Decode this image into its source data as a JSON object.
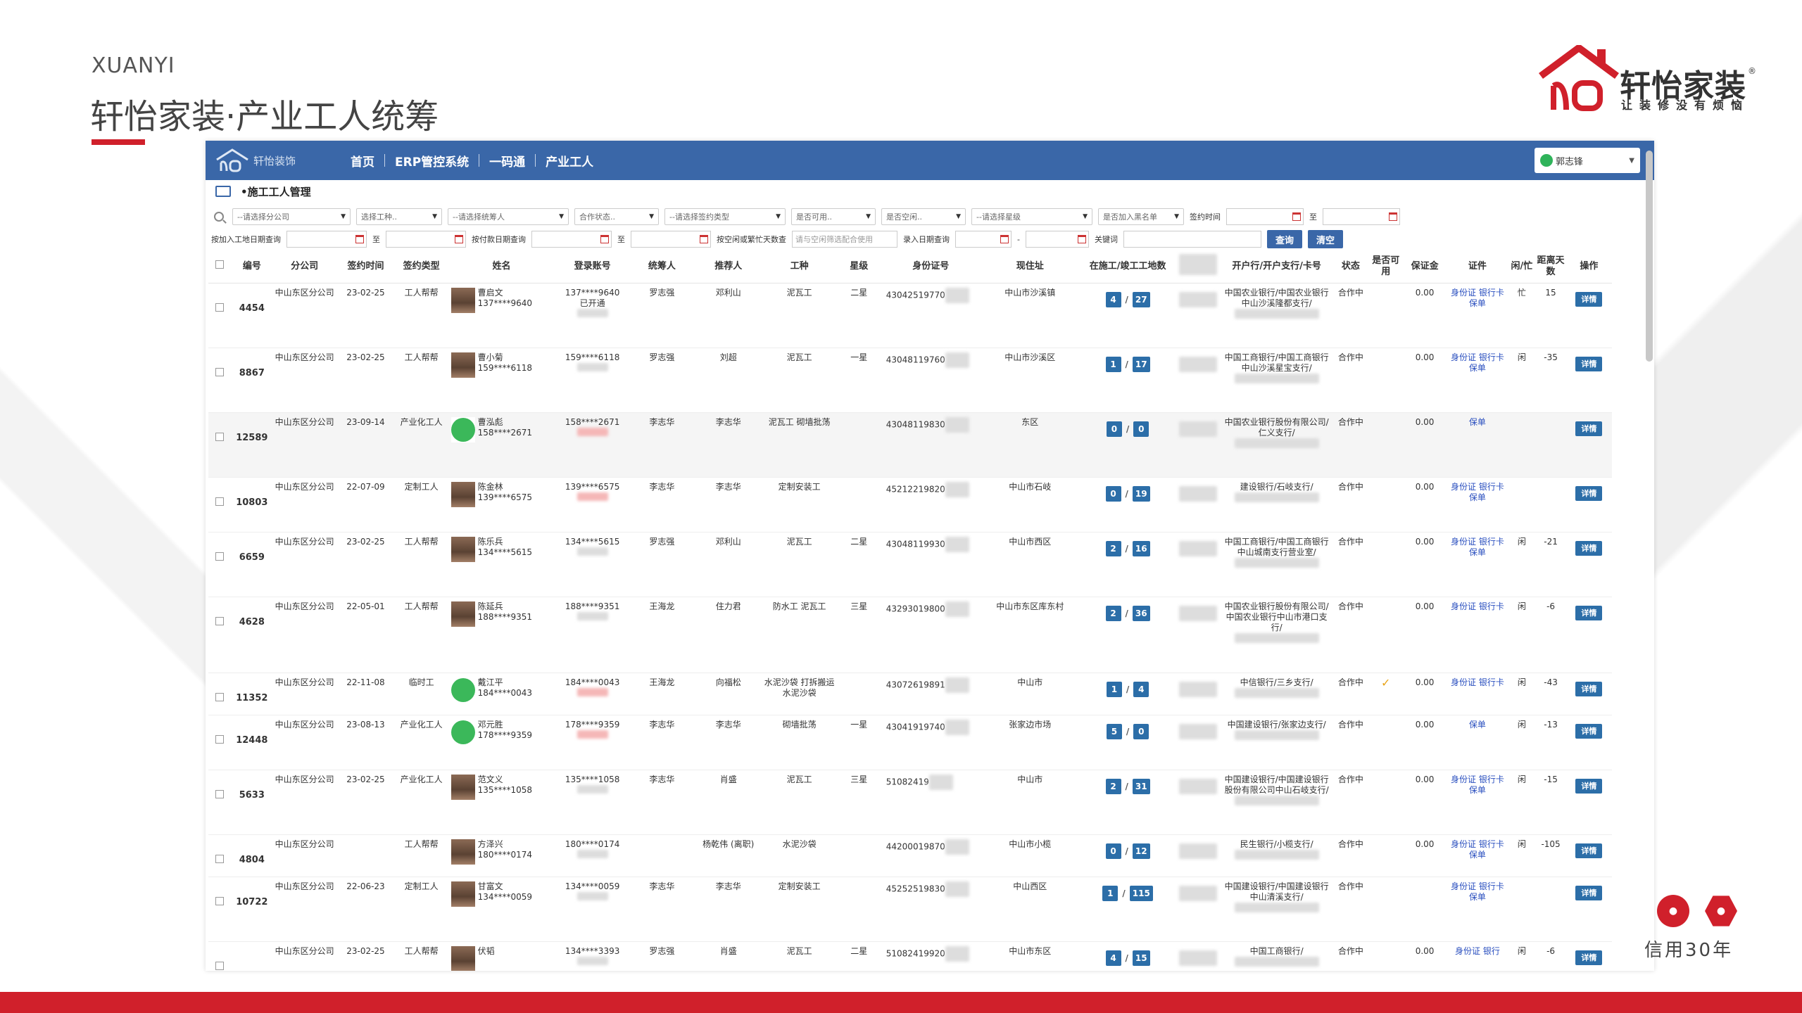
{
  "slide": {
    "brand_en": "XUANYI",
    "title": "轩怡家装·产业工人统筹",
    "logo_name": "轩怡家装",
    "logo_slogan": "让装修没有烦恼",
    "logo_reg": "®",
    "years_text": "信用30年",
    "colors": {
      "brand_red": "#d0202b",
      "nav_blue": "#3a67a8"
    }
  },
  "app": {
    "logo_text": "轩怡装饰",
    "nav": [
      "首页",
      "ERP管控系统",
      "一码通",
      "产业工人"
    ],
    "user_name": "郭志锋",
    "breadcrumb": "•施工工人管理",
    "filters": {
      "row1": [
        "--请选择分公司",
        "选择工种..",
        "--请选择统筹人",
        "合作状态..",
        "--请选择签约类型",
        "是否可用..",
        "是否空闲..",
        "--请选择星级",
        "是否加入黑名单"
      ],
      "sign_time_label": "签约时间",
      "to": "至",
      "join_site_label": "按加入工地日期查询",
      "pay_date_label": "按付款日期查询",
      "idle_label": "按空闲或繁忙天数查",
      "idle_placeholder": "请与空闲筛选配合使用",
      "entry_date_label": "录入日期查询",
      "dash": "-",
      "keyword_label": "关键词",
      "search_btn": "查询",
      "clear_btn": "清空"
    },
    "columns": [
      "编号",
      "分公司",
      "签约时间",
      "签约类型",
      "姓名",
      "登录账号",
      "统筹人",
      "推荐人",
      "工种",
      "星级",
      "身份证号",
      "现住址",
      "在施工/竣工工地数",
      "",
      "开户行/开户支行/卡号",
      "状态",
      "是否可用",
      "保证金",
      "证件",
      "闲/忙",
      "距离天数",
      "操作"
    ],
    "rows": [
      {
        "id": "4454",
        "branch": "中山东区分公司",
        "date": "23-02-25",
        "type": "工人帮帮",
        "name": "曹启文",
        "phone": "137****9640",
        "account": "137****9640",
        "account_note": "已开通",
        "coord": "罗志强",
        "ref": "邓利山",
        "trade": "泥瓦工",
        "star": "二星",
        "idno": "43042519770",
        "addr": "中山市沙溪镇",
        "active": "4",
        "done": "27",
        "bank": "中国农业银行/中国农业银行中山沙溪隆都支行/",
        "status": "合作中",
        "usable": "",
        "deposit": "0.00",
        "docs": "身份证 银行卡 保单",
        "idle": "忙",
        "days": "15",
        "op": "详情"
      },
      {
        "id": "8867",
        "branch": "中山东区分公司",
        "date": "23-02-25",
        "type": "工人帮帮",
        "name": "曹小菊",
        "phone": "159****6118",
        "account": "159****6118",
        "account_note": "",
        "coord": "罗志强",
        "ref": "刘超",
        "trade": "泥瓦工",
        "star": "一星",
        "idno": "43048119760",
        "addr": "中山市沙溪区",
        "active": "1",
        "done": "17",
        "bank": "中国工商银行/中国工商银行中山沙溪星宝支行/",
        "status": "合作中",
        "usable": "",
        "deposit": "0.00",
        "docs": "身份证 银行卡 保单",
        "idle": "闲",
        "days": "-35",
        "op": "详情"
      },
      {
        "id": "12589",
        "branch": "中山东区分公司",
        "date": "23-09-14",
        "type": "产业化工人",
        "name": "曹泓彪",
        "phone": "158****2671",
        "account": "158****2671",
        "account_note": "",
        "coord": "李志华",
        "ref": "李志华",
        "trade": "泥瓦工 砌墙批荡",
        "star": "",
        "idno": "43048119830",
        "addr": "东区",
        "active": "0",
        "done": "0",
        "bank": "中国农业银行股份有限公司/仁义支行/",
        "status": "合作中",
        "usable": "",
        "deposit": "0.00",
        "docs": "保单",
        "idle": "",
        "days": "",
        "op": "详情"
      },
      {
        "id": "10803",
        "branch": "中山东区分公司",
        "date": "22-07-09",
        "type": "定制工人",
        "name": "陈金林",
        "phone": "139****6575",
        "account": "139****6575",
        "account_note": "",
        "coord": "李志华",
        "ref": "李志华",
        "trade": "定制安装工",
        "star": "",
        "idno": "45212219820",
        "addr": "中山市石岐",
        "active": "0",
        "done": "19",
        "bank": "建设银行/石岐支行/",
        "status": "合作中",
        "usable": "",
        "deposit": "0.00",
        "docs": "身份证 银行卡 保单",
        "idle": "",
        "days": "",
        "op": "详情"
      },
      {
        "id": "6659",
        "branch": "中山东区分公司",
        "date": "23-02-25",
        "type": "工人帮帮",
        "name": "陈乐兵",
        "phone": "134****5615",
        "account": "134****5615",
        "account_note": "",
        "coord": "罗志强",
        "ref": "邓利山",
        "trade": "泥瓦工",
        "star": "二星",
        "idno": "43048119930",
        "addr": "中山市西区",
        "active": "2",
        "done": "16",
        "bank": "中国工商银行/中国工商银行中山城南支行营业室/",
        "status": "合作中",
        "usable": "",
        "deposit": "0.00",
        "docs": "身份证 银行卡 保单",
        "idle": "闲",
        "days": "-21",
        "op": "详情"
      },
      {
        "id": "4628",
        "branch": "中山东区分公司",
        "date": "22-05-01",
        "type": "工人帮帮",
        "name": "陈延兵",
        "phone": "188****9351",
        "account": "188****9351",
        "account_note": "",
        "coord": "王海龙",
        "ref": "住力君",
        "trade": "防水工 泥瓦工",
        "star": "三星",
        "idno": "43293019800",
        "addr": "中山市东区库东村",
        "active": "2",
        "done": "36",
        "bank": "中国农业银行股份有限公司/中国农业银行中山市港口支行/",
        "status": "合作中",
        "usable": "",
        "deposit": "0.00",
        "docs": "身份证 银行卡",
        "idle": "闲",
        "days": "-6",
        "op": "详情"
      },
      {
        "id": "11352",
        "branch": "中山东区分公司",
        "date": "22-11-08",
        "type": "临时工",
        "name": "戴江平",
        "phone": "184****0043",
        "account": "184****0043",
        "account_note": "",
        "coord": "王海龙",
        "ref": "向福松",
        "trade": "水泥沙袋 打拆搬运水泥沙袋",
        "star": "",
        "idno": "43072619891",
        "addr": "中山市",
        "active": "1",
        "done": "4",
        "bank": "中信银行/三乡支行/",
        "status": "合作中",
        "usable": "✓",
        "deposit": "0.00",
        "docs": "身份证 银行卡",
        "idle": "闲",
        "days": "-43",
        "op": "详情"
      },
      {
        "id": "12448",
        "branch": "中山东区分公司",
        "date": "23-08-13",
        "type": "产业化工人",
        "name": "邓元胜",
        "phone": "178****9359",
        "account": "178****9359",
        "account_note": "",
        "coord": "李志华",
        "ref": "李志华",
        "trade": "砌墙批荡",
        "star": "一星",
        "idno": "43041919740",
        "addr": "张家边市场",
        "active": "5",
        "done": "0",
        "bank": "中国建设银行/张家边支行/",
        "status": "合作中",
        "usable": "",
        "deposit": "0.00",
        "docs": "保单",
        "idle": "闲",
        "days": "-13",
        "op": "详情"
      },
      {
        "id": "5633",
        "branch": "中山东区分公司",
        "date": "23-02-25",
        "type": "产业化工人",
        "name": "范文义",
        "phone": "135****1058",
        "account": "135****1058",
        "account_note": "",
        "coord": "李志华",
        "ref": "肖盛",
        "trade": "泥瓦工",
        "star": "三星",
        "idno": "51082419",
        "addr": "中山市",
        "active": "2",
        "done": "31",
        "bank": "中国建设银行/中国建设银行股份有限公司中山石岐支行/",
        "status": "合作中",
        "usable": "",
        "deposit": "0.00",
        "docs": "身份证 银行卡 保单",
        "idle": "闲",
        "days": "-15",
        "op": "详情"
      },
      {
        "id": "4804",
        "branch": "中山东区分公司",
        "date": "",
        "type": "工人帮帮",
        "name": "方泽兴",
        "phone": "180****0174",
        "account": "180****0174",
        "account_note": "",
        "coord": "",
        "ref": "杨乾伟 (离职)",
        "trade": "水泥沙袋",
        "star": "",
        "idno": "44200019870",
        "addr": "中山市小榄",
        "active": "0",
        "done": "12",
        "bank": "民生银行/小榄支行/",
        "status": "合作中",
        "usable": "",
        "deposit": "0.00",
        "docs": "身份证 银行卡 保单",
        "idle": "闲",
        "days": "-105",
        "op": "详情"
      },
      {
        "id": "10722",
        "branch": "中山东区分公司",
        "date": "22-06-23",
        "type": "定制工人",
        "name": "甘富文",
        "phone": "134****0059",
        "account": "134****0059",
        "account_note": "",
        "coord": "李志华",
        "ref": "李志华",
        "trade": "定制安装工",
        "star": "",
        "idno": "45252519830",
        "addr": "中山西区",
        "active": "1",
        "done": "115",
        "bank": "中国建设银行/中国建设银行中山清溪支行/",
        "status": "合作中",
        "usable": "",
        "deposit": "",
        "docs": "身份证 银行卡 保单",
        "idle": "",
        "days": "",
        "op": "详情"
      },
      {
        "id": "",
        "branch": "中山东区分公司",
        "date": "23-02-25",
        "type": "工人帮帮",
        "name": "伏韬",
        "phone": "",
        "account": "134****3393",
        "account_note": "",
        "coord": "罗志强",
        "ref": "肖盛",
        "trade": "泥瓦工",
        "star": "二星",
        "idno": "51082419920",
        "addr": "中山市东区",
        "active": "4",
        "done": "15",
        "bank": "中国工商银行/",
        "status": "合作中",
        "usable": "",
        "deposit": "0.00",
        "docs": "身份证 银行",
        "idle": "闲",
        "days": "-6",
        "op": "详情"
      }
    ]
  }
}
